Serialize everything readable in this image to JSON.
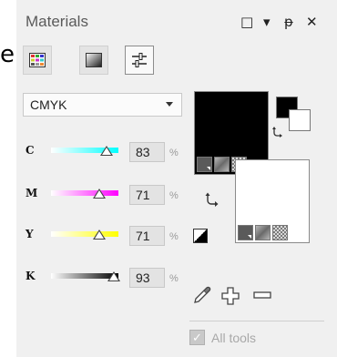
{
  "panel": {
    "title": "Materials",
    "edge_glyph": "e",
    "controls": {
      "maximize": "□",
      "menu": "▾",
      "pin": "ᵽ",
      "close": "✕"
    }
  },
  "modes": [
    {
      "name": "swatches",
      "icon": "grid-swatch-icon",
      "active": false
    },
    {
      "name": "gradient",
      "icon": "gradient-icon",
      "active": false
    },
    {
      "name": "sliders",
      "icon": "sliders-icon",
      "active": true
    }
  ],
  "color_model": {
    "selected": "CMYK"
  },
  "channels": [
    {
      "label": "C",
      "value": "83",
      "unit": "%",
      "fraction": 0.83,
      "gradient": [
        "#ffffff",
        "#00ffff"
      ]
    },
    {
      "label": "M",
      "value": "71",
      "unit": "%",
      "fraction": 0.71,
      "gradient": [
        "#ffffff",
        "#ff00ff"
      ]
    },
    {
      "label": "Y",
      "value": "71",
      "unit": "%",
      "fraction": 0.71,
      "gradient": [
        "#ffffff",
        "#ffff00"
      ]
    },
    {
      "label": "K",
      "value": "93",
      "unit": "%",
      "fraction": 0.93,
      "gradient": [
        "#ffffff",
        "#000000"
      ]
    }
  ],
  "foreground_color": "#000000",
  "background_color": "#ffffff",
  "tools": {
    "eyedropper": "eyedropper-icon",
    "add": "+",
    "remove": "−"
  },
  "all_tools": {
    "label": "All tools",
    "checked": true,
    "check_mark": "✓"
  }
}
